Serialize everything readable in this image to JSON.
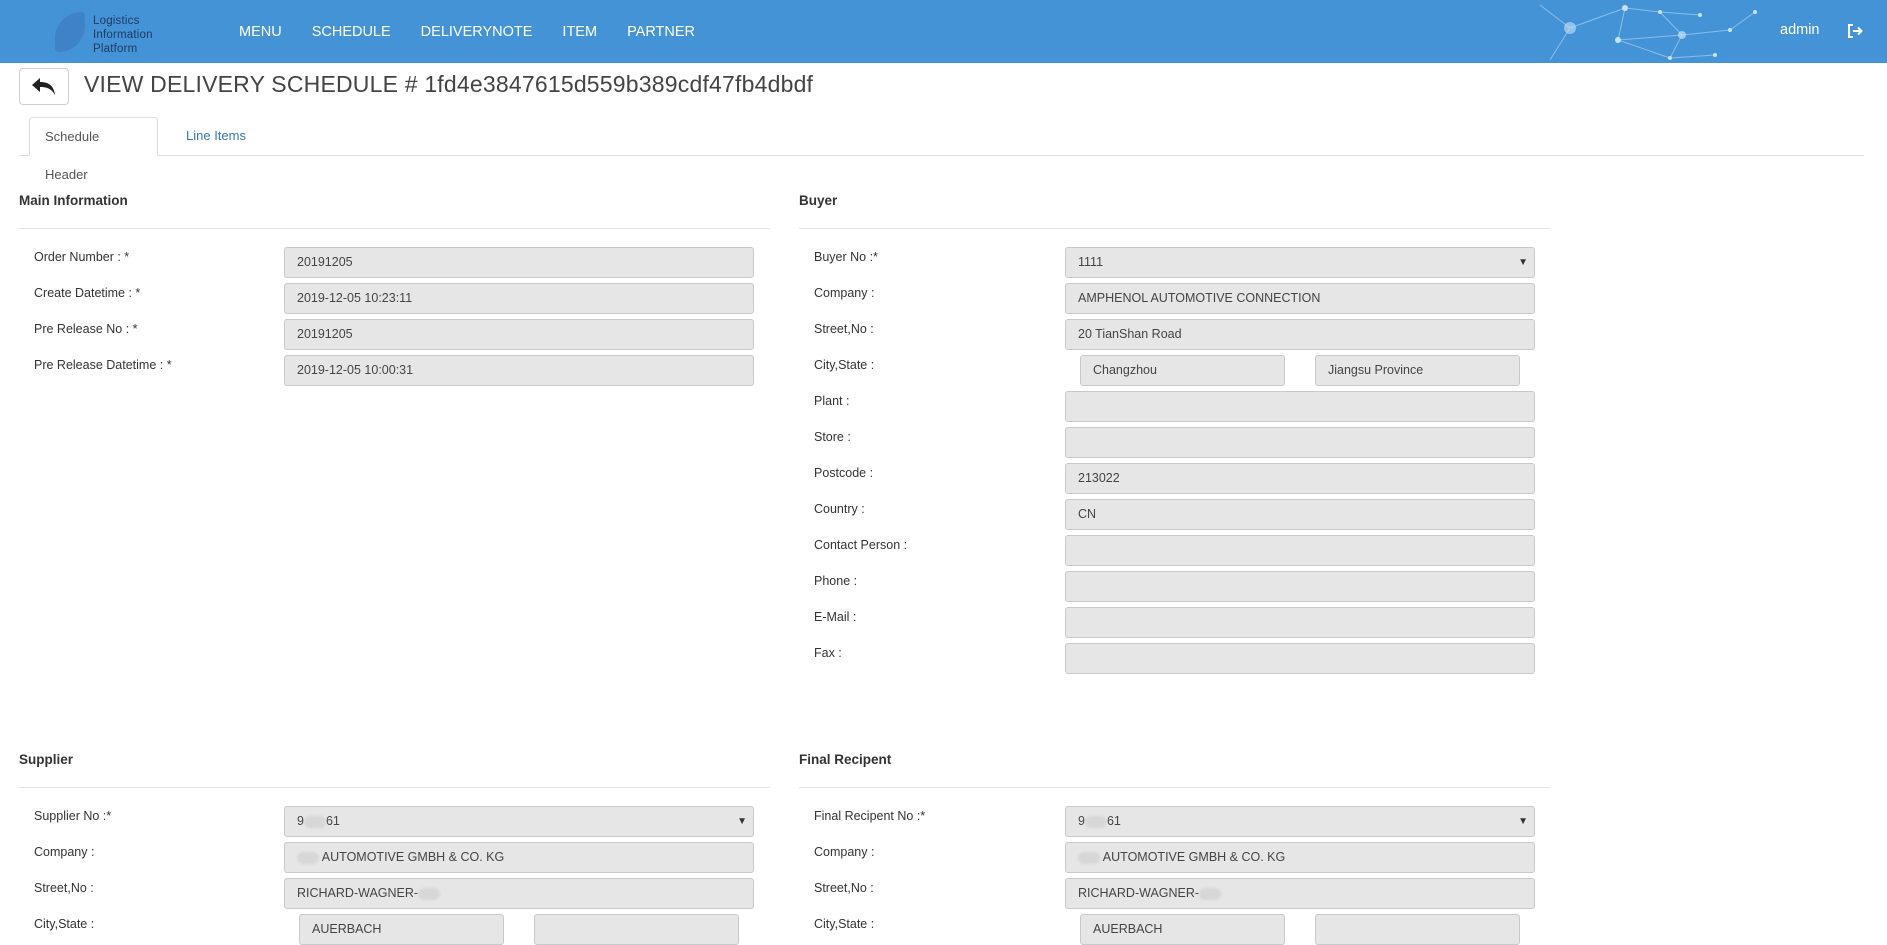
{
  "app": {
    "logo_lines": [
      "Logistics",
      "Information",
      "Platform"
    ],
    "nav": [
      "MENU",
      "SCHEDULE",
      "DELIVERYNOTE",
      "ITEM",
      "PARTNER"
    ],
    "user": "admin",
    "accent_color": "#4493d6"
  },
  "page": {
    "title": "VIEW DELIVERY SCHEDULE # 1fd4e3847615d559b389cdf47fb4dbdf",
    "tabs": [
      {
        "label": "Schedule Header",
        "active": true
      },
      {
        "label": "Line Items",
        "active": false
      }
    ]
  },
  "main_information": {
    "title": "Main Information",
    "fields": [
      {
        "label": "Order Number : *",
        "value": "20191205"
      },
      {
        "label": "Create Datetime : *",
        "value": "2019-12-05 10:23:11"
      },
      {
        "label": "Pre Release No : *",
        "value": "20191205"
      },
      {
        "label": "Pre Release Datetime : *",
        "value": "2019-12-05 10:00:31"
      }
    ]
  },
  "buyer": {
    "title": "Buyer",
    "buyer_no_label": "Buyer No :*",
    "buyer_no": "1111",
    "company_label": "Company :",
    "company": "AMPHENOL AUTOMOTIVE CONNECTION",
    "street_label": "Street,No :",
    "street": "20 TianShan Road",
    "city_state_label": "City,State :",
    "city": "Changzhou",
    "state": "Jiangsu Province",
    "plant_label": "Plant :",
    "plant": "",
    "store_label": "Store :",
    "store": "",
    "postcode_label": "Postcode :",
    "postcode": "213022",
    "country_label": "Country :",
    "country": "CN",
    "contact_label": "Contact Person :",
    "contact": "",
    "phone_label": "Phone :",
    "phone": "",
    "email_label": "E-Mail :",
    "email": "",
    "fax_label": "Fax :",
    "fax": ""
  },
  "supplier": {
    "title": "Supplier",
    "no_label": "Supplier No :*",
    "no_start": "9",
    "no_end": "61",
    "company_label": "Company :",
    "company": "AUTOMOTIVE GMBH & CO. KG",
    "street_label": "Street,No :",
    "street": "RICHARD-WAGNER-",
    "city_state_label": "City,State :",
    "city": "AUERBACH",
    "state": ""
  },
  "final_recipient": {
    "title": "Final Recipent",
    "no_label": "Final Recipent No :*",
    "no_start": "9",
    "no_end": "61",
    "company_label": "Company :",
    "company": "AUTOMOTIVE GMBH & CO. KG",
    "street_label": "Street,No :",
    "street": "RICHARD-WAGNER-",
    "city_state_label": "City,State :",
    "city": "AUERBACH",
    "state": ""
  }
}
